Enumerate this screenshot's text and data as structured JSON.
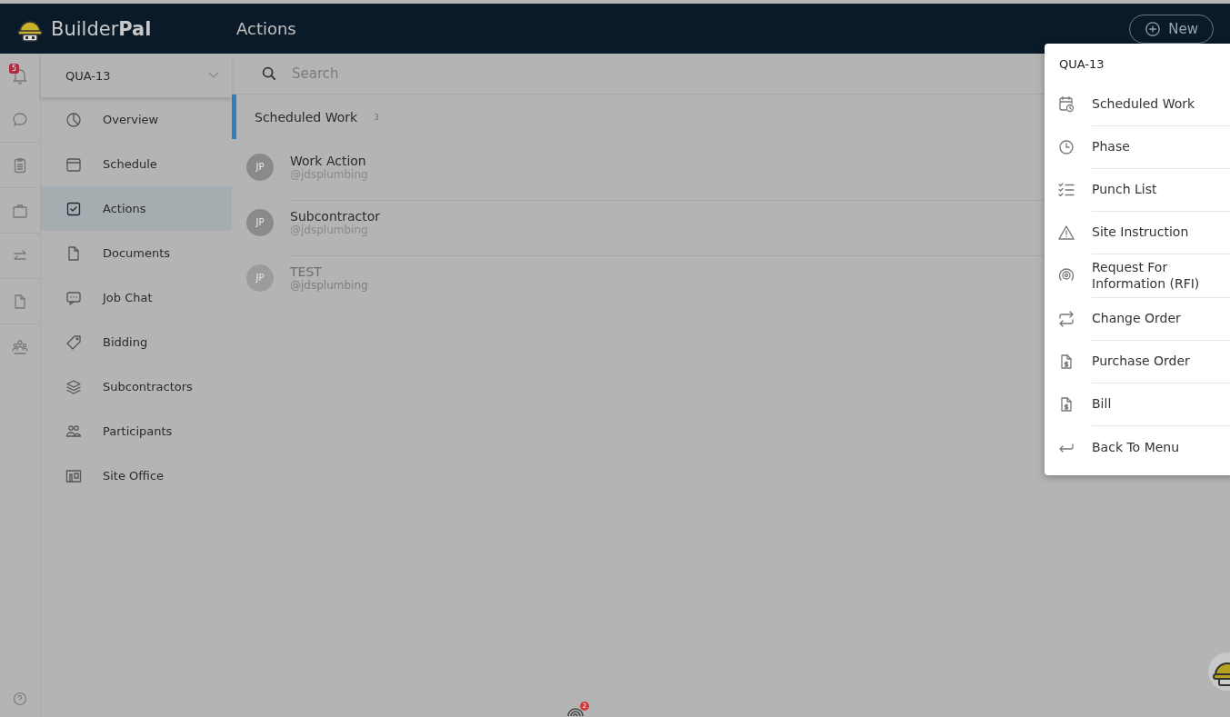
{
  "header": {
    "brand": "Builder**Pal**",
    "title": "Actions",
    "new_button": "New"
  },
  "rail": {
    "notification_count": "5"
  },
  "sidebar": {
    "project": "QUA-13",
    "items": [
      {
        "label": "Overview",
        "selected": false
      },
      {
        "label": "Schedule",
        "selected": false
      },
      {
        "label": "Actions",
        "selected": true
      },
      {
        "label": "Documents",
        "selected": false
      },
      {
        "label": "Job Chat",
        "selected": false
      },
      {
        "label": "Bidding",
        "selected": false
      },
      {
        "label": "Subcontractors",
        "selected": false
      },
      {
        "label": "Participants",
        "selected": false
      },
      {
        "label": "Site Office",
        "selected": false
      }
    ]
  },
  "search": {
    "placeholder": "Search"
  },
  "section": {
    "title": "Scheduled Work",
    "count": "3"
  },
  "actions": [
    {
      "avatar": "JP",
      "title": "Work Action",
      "handle": "@jdsplumbing",
      "disabled": false
    },
    {
      "avatar": "JP",
      "title": "Subcontractor",
      "handle": "@jdsplumbing",
      "disabled": false
    },
    {
      "avatar": "JP",
      "title": "TEST",
      "handle": "@jdsplumbing",
      "disabled": true
    }
  ],
  "menu": {
    "title": "QUA-13",
    "items": [
      "Scheduled Work",
      "Phase",
      "Punch List",
      "Site Instruction",
      "Request For Information (RFI)",
      "Change Order",
      "Purchase Order",
      "Bill",
      "Back To Menu"
    ]
  },
  "bottom_badge": "2"
}
